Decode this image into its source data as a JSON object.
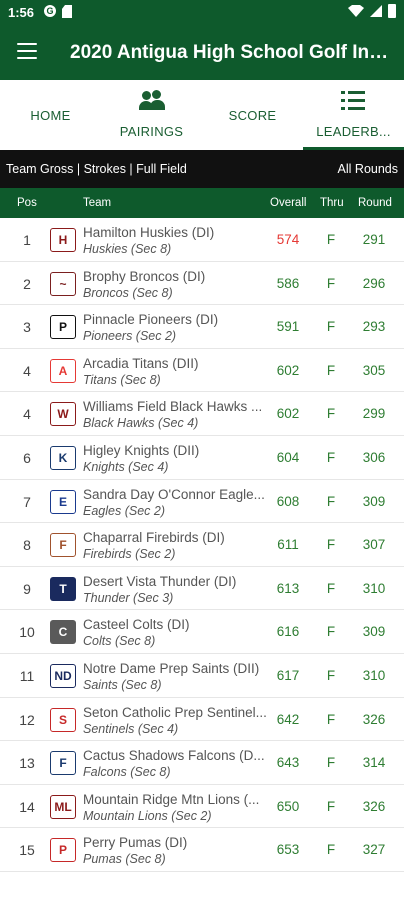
{
  "status_bar": {
    "time": "1:56",
    "g_icon": "G"
  },
  "app_bar": {
    "title": "2020 Antigua High School Golf Invi..."
  },
  "tabs": [
    {
      "label": "HOME",
      "icon": "none"
    },
    {
      "label": "PAIRINGS",
      "icon": "people-icon"
    },
    {
      "label": "SCORE",
      "icon": "none"
    },
    {
      "label": "LEADERB...",
      "icon": "list-icon",
      "active": true
    }
  ],
  "filter": {
    "left": "Team Gross | Strokes | Full Field",
    "right": "All Rounds"
  },
  "columns": {
    "pos": "Pos",
    "team": "Team",
    "overall": "Overall",
    "thru": "Thru",
    "round": "Round"
  },
  "rows": [
    {
      "pos": "1",
      "name": "Hamilton Huskies (DI)",
      "sub": "Huskies (Sec 8)",
      "overall": "574",
      "thru": "F",
      "round": "291",
      "logo_text": "H",
      "logo_color": "#8b1a1a",
      "logo_bg": "#ffffff",
      "leader": true
    },
    {
      "pos": "2",
      "name": "Brophy Broncos (DI)",
      "sub": "Broncos (Sec 8)",
      "overall": "586",
      "thru": "F",
      "round": "296",
      "logo_text": "~",
      "logo_color": "#7a1f1f",
      "logo_bg": "#ffffff"
    },
    {
      "pos": "3",
      "name": "Pinnacle Pioneers (DI)",
      "sub": "Pioneers (Sec 2)",
      "overall": "591",
      "thru": "F",
      "round": "293",
      "logo_text": "P",
      "logo_color": "#111111",
      "logo_bg": "#ffffff"
    },
    {
      "pos": "4",
      "name": "Arcadia Titans (DII)",
      "sub": "Titans (Sec 8)",
      "overall": "602",
      "thru": "F",
      "round": "305",
      "logo_text": "A",
      "logo_color": "#e53935",
      "logo_bg": "#ffffff"
    },
    {
      "pos": "4",
      "name": "Williams Field Black Hawks ...",
      "sub": "Black Hawks (Sec 4)",
      "overall": "602",
      "thru": "F",
      "round": "299",
      "logo_text": "W",
      "logo_color": "#8b1a1a",
      "logo_bg": "#ffffff"
    },
    {
      "pos": "6",
      "name": "Higley Knights (DII)",
      "sub": "Knights (Sec 4)",
      "overall": "604",
      "thru": "F",
      "round": "306",
      "logo_text": "K",
      "logo_color": "#1a3a6e",
      "logo_bg": "#ffffff"
    },
    {
      "pos": "7",
      "name": "Sandra Day O'Connor  Eagle...",
      "sub": "Eagles (Sec 2)",
      "overall": "608",
      "thru": "F",
      "round": "309",
      "logo_text": "E",
      "logo_color": "#1a3a8e",
      "logo_bg": "#ffffff"
    },
    {
      "pos": "8",
      "name": "Chaparral Firebirds (DI)",
      "sub": "Firebirds (Sec 2)",
      "overall": "611",
      "thru": "F",
      "round": "307",
      "logo_text": "F",
      "logo_color": "#a0522d",
      "logo_bg": "#ffffff"
    },
    {
      "pos": "9",
      "name": "Desert Vista Thunder (DI)",
      "sub": "Thunder (Sec 3)",
      "overall": "613",
      "thru": "F",
      "round": "310",
      "logo_text": "T",
      "logo_color": "#ffffff",
      "logo_bg": "#1a2a5e"
    },
    {
      "pos": "10",
      "name": "Casteel Colts (DI)",
      "sub": "Colts (Sec 8)",
      "overall": "616",
      "thru": "F",
      "round": "309",
      "logo_text": "C",
      "logo_color": "#ffffff",
      "logo_bg": "#5a5a5a"
    },
    {
      "pos": "11",
      "name": "Notre Dame Prep Saints (DII)",
      "sub": "Saints (Sec 8)",
      "overall": "617",
      "thru": "F",
      "round": "310",
      "logo_text": "ND",
      "logo_color": "#1a2a5e",
      "logo_bg": "#ffffff"
    },
    {
      "pos": "12",
      "name": "Seton Catholic Prep Sentinel...",
      "sub": "Sentinels  (Sec 4)",
      "overall": "642",
      "thru": "F",
      "round": "326",
      "logo_text": "S",
      "logo_color": "#c62828",
      "logo_bg": "#ffffff"
    },
    {
      "pos": "13",
      "name": "Cactus Shadows Falcons (D...",
      "sub": "Falcons (Sec 8)",
      "overall": "643",
      "thru": "F",
      "round": "314",
      "logo_text": "F",
      "logo_color": "#1a3a6e",
      "logo_bg": "#ffffff"
    },
    {
      "pos": "14",
      "name": "Mountain Ridge Mtn Lions (...",
      "sub": "Mountain Lions (Sec 2)",
      "overall": "650",
      "thru": "F",
      "round": "326",
      "logo_text": "ML",
      "logo_color": "#8b1a1a",
      "logo_bg": "#ffffff"
    },
    {
      "pos": "15",
      "name": "Perry Pumas (DI)",
      "sub": "Pumas (Sec 8)",
      "overall": "653",
      "thru": "F",
      "round": "327",
      "logo_text": "P",
      "logo_color": "#c62828",
      "logo_bg": "#ffffff"
    }
  ]
}
